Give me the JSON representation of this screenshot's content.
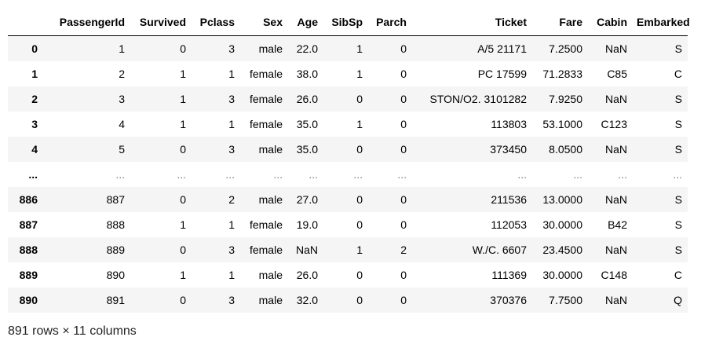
{
  "table": {
    "columns": [
      "",
      "PassengerId",
      "Survived",
      "Pclass",
      "Sex",
      "Age",
      "SibSp",
      "Parch",
      "Ticket",
      "Fare",
      "Cabin",
      "Embarked"
    ],
    "rows": [
      [
        "0",
        "1",
        "0",
        "3",
        "male",
        "22.0",
        "1",
        "0",
        "A/5 21171",
        "7.2500",
        "NaN",
        "S"
      ],
      [
        "1",
        "2",
        "1",
        "1",
        "female",
        "38.0",
        "1",
        "0",
        "PC 17599",
        "71.2833",
        "C85",
        "C"
      ],
      [
        "2",
        "3",
        "1",
        "3",
        "female",
        "26.0",
        "0",
        "0",
        "STON/O2. 3101282",
        "7.9250",
        "NaN",
        "S"
      ],
      [
        "3",
        "4",
        "1",
        "1",
        "female",
        "35.0",
        "1",
        "0",
        "113803",
        "53.1000",
        "C123",
        "S"
      ],
      [
        "4",
        "5",
        "0",
        "3",
        "male",
        "35.0",
        "0",
        "0",
        "373450",
        "8.0500",
        "NaN",
        "S"
      ],
      [
        "...",
        "...",
        "...",
        "...",
        "...",
        "...",
        "...",
        "...",
        "...",
        "...",
        "...",
        "..."
      ],
      [
        "886",
        "887",
        "0",
        "2",
        "male",
        "27.0",
        "0",
        "0",
        "211536",
        "13.0000",
        "NaN",
        "S"
      ],
      [
        "887",
        "888",
        "1",
        "1",
        "female",
        "19.0",
        "0",
        "0",
        "112053",
        "30.0000",
        "B42",
        "S"
      ],
      [
        "888",
        "889",
        "0",
        "3",
        "female",
        "NaN",
        "1",
        "2",
        "W./C. 6607",
        "23.4500",
        "NaN",
        "S"
      ],
      [
        "889",
        "890",
        "1",
        "1",
        "male",
        "26.0",
        "0",
        "0",
        "111369",
        "30.0000",
        "C148",
        "C"
      ],
      [
        "890",
        "891",
        "0",
        "3",
        "male",
        "32.0",
        "0",
        "0",
        "370376",
        "7.7500",
        "NaN",
        "Q"
      ]
    ]
  },
  "shape_text": "891 rows × 11 columns"
}
